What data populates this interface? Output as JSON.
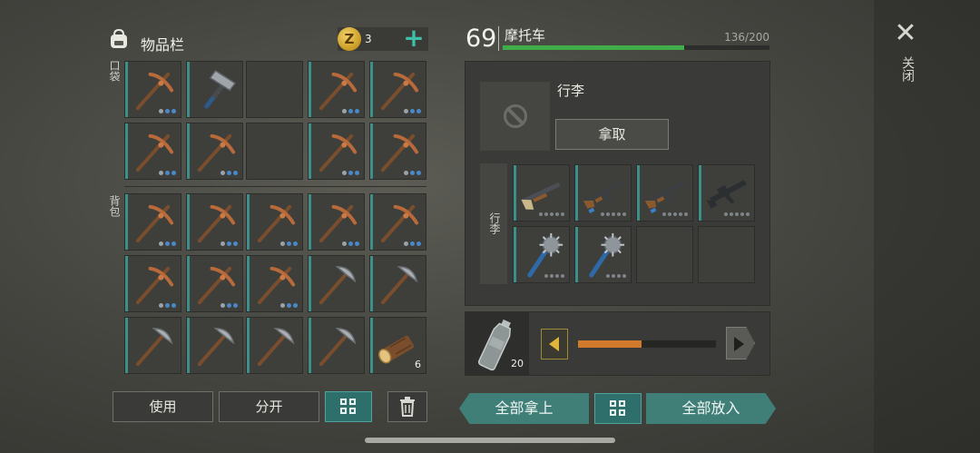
{
  "inventory": {
    "title": "物品栏",
    "coin_symbol": "Z",
    "coin_count": "3",
    "add_label": "+",
    "pocket_label": "口袋",
    "backpack_label": "背包",
    "slots": [
      {
        "item": "pickaxe-icon",
        "dots": "wbb"
      },
      {
        "item": "hammer-icon",
        "dots": ""
      },
      {
        "item": "",
        "dots": ""
      },
      {
        "item": "pickaxe-icon",
        "dots": "wbb"
      },
      {
        "item": "pickaxe-icon",
        "dots": "wbb"
      },
      {
        "item": "pickaxe-icon",
        "dots": "wbb"
      },
      {
        "item": "pickaxe-icon",
        "dots": "wbb"
      },
      {
        "item": "",
        "dots": ""
      },
      {
        "item": "pickaxe-icon",
        "dots": "wbb"
      },
      {
        "item": "pickaxe-icon",
        "dots": "wbb"
      },
      {
        "item": "pickaxe-icon",
        "dots": "wbb"
      },
      {
        "item": "pickaxe-icon",
        "dots": "wbb"
      },
      {
        "item": "pickaxe-icon",
        "dots": "wbb"
      },
      {
        "item": "pickaxe-icon",
        "dots": "wbb"
      },
      {
        "item": "pickaxe-icon",
        "dots": "wbb"
      },
      {
        "item": "pickaxe-icon",
        "dots": "wbb"
      },
      {
        "item": "pickaxe-icon",
        "dots": "wbb"
      },
      {
        "item": "pickaxe-icon",
        "dots": "wbb"
      },
      {
        "item": "stone-pickaxe-icon",
        "dots": ""
      },
      {
        "item": "stone-pickaxe-icon",
        "dots": ""
      },
      {
        "item": "stone-pickaxe-icon",
        "dots": ""
      },
      {
        "item": "stone-pickaxe-icon",
        "dots": ""
      },
      {
        "item": "stone-pickaxe-icon",
        "dots": ""
      },
      {
        "item": "stone-pickaxe-icon",
        "dots": ""
      },
      {
        "item": "log-icon",
        "qty": "6"
      }
    ],
    "buttons": {
      "use": "使用",
      "split": "分开"
    }
  },
  "vehicle": {
    "level": "69",
    "name": "摩托车",
    "capacity": "136/200",
    "capacity_fraction": 0.68,
    "bag_name": "行李",
    "take_label": "拿取",
    "side_label": "行李",
    "slots": [
      {
        "item": "shotgun-icon"
      },
      {
        "item": "ak-rifle-icon"
      },
      {
        "item": "ak-rifle-icon"
      },
      {
        "item": "m16-rifle-icon"
      },
      {
        "item": "spiked-mace-icon"
      },
      {
        "item": "spiked-mace-icon"
      },
      {
        "item": ""
      },
      {
        "item": ""
      }
    ],
    "bottle_qty": "20",
    "amount_fraction": 0.46,
    "take_all": "全部拿上",
    "put_all": "全部放入"
  },
  "close": {
    "symbol": "✕",
    "label": "关闭"
  },
  "colors": {
    "accent": "#3f7f78",
    "capacity_bar": "#3fae4a",
    "amount_bar": "#d17a2c"
  }
}
